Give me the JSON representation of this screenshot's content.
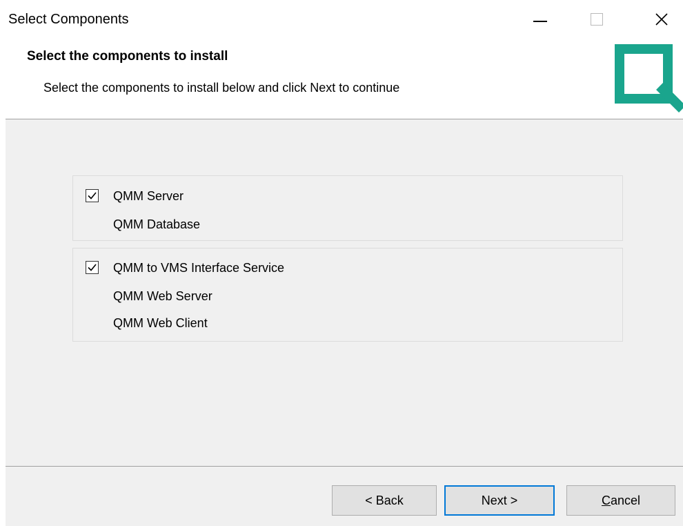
{
  "window": {
    "title": "Select Components",
    "controls": {
      "minimize": "minimize",
      "maximize": "maximize",
      "close": "close"
    }
  },
  "header": {
    "title": "Select the components to install",
    "subtitle": "Select the components to install below and click Next to continue",
    "logo_color": "#1aa58d"
  },
  "components": {
    "group1": {
      "checkbox_label": "QMM Server",
      "checked": true,
      "items": [
        "QMM Database"
      ]
    },
    "group2": {
      "checkbox_label": "QMM to VMS Interface Service",
      "checked": true,
      "items": [
        "QMM Web Server",
        "QMM Web Client"
      ]
    }
  },
  "footer": {
    "back_label": "< Back",
    "next_label": "Next >",
    "cancel_first": "C",
    "cancel_rest": "ancel"
  }
}
